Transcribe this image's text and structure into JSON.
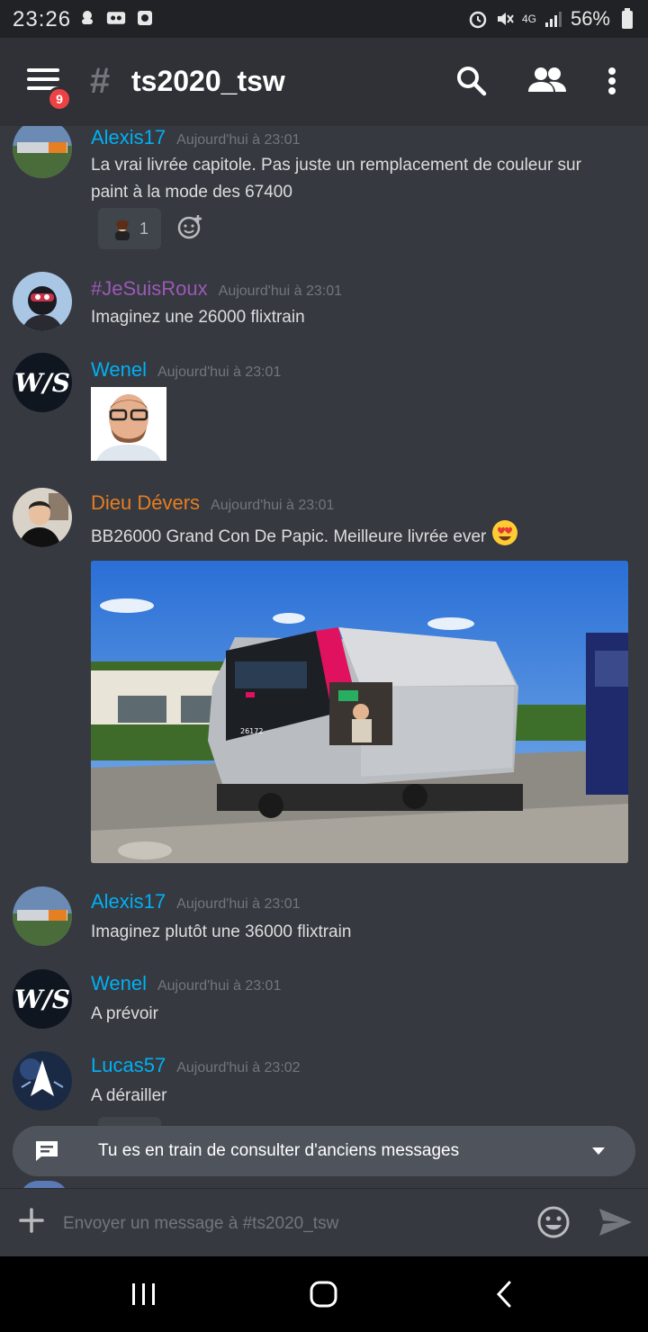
{
  "status_bar": {
    "time": "23:26",
    "network": "4G",
    "battery": "56%"
  },
  "header": {
    "channel": "ts2020_tsw",
    "notification_count": "9",
    "hash": "#"
  },
  "messages": [
    {
      "author": "Alexis17",
      "author_color": "#00b0f4",
      "timestamp": "Aujourd'hui à 23:01",
      "text": "La vrai livrée capitole. Pas juste un remplacement de couleur sur paint à la mode des 67400",
      "reaction_count": "1"
    },
    {
      "author": "#JeSuisRoux",
      "author_color": "#9b59b6",
      "timestamp": "Aujourd'hui à 23:01",
      "text": "Imaginez une 26000 flixtrain"
    },
    {
      "author": "Wenel",
      "author_color": "#00b0f4",
      "timestamp": "Aujourd'hui à 23:01",
      "text": ""
    },
    {
      "author": "Dieu Dévers",
      "author_color": "#e67e22",
      "timestamp": "Aujourd'hui à 23:01",
      "text": "BB26000 Grand Con De Papic. Meilleure livrée ever",
      "loco_number": "26172"
    },
    {
      "author": "Alexis17",
      "author_color": "#00b0f4",
      "timestamp": "Aujourd'hui à 23:01",
      "text": "Imaginez plutôt une 36000 flixtrain"
    },
    {
      "author": "Wenel",
      "author_color": "#00b0f4",
      "timestamp": "Aujourd'hui à 23:01",
      "text": "A prévoir"
    },
    {
      "author": "Lucas57",
      "author_color": "#00b0f4",
      "timestamp": "Aujourd'hui à 23:02",
      "text": "A dérailler"
    }
  ],
  "wenel_avatar_text": "W/S",
  "banner": {
    "text": "Tu es en train de consulter d'anciens messages"
  },
  "composer": {
    "placeholder": "Envoyer un message à #ts2020_tsw"
  },
  "colors": {
    "background": "#36393f",
    "header": "#2f3136",
    "blurple": "#7289da",
    "badge": "#ed4245"
  }
}
